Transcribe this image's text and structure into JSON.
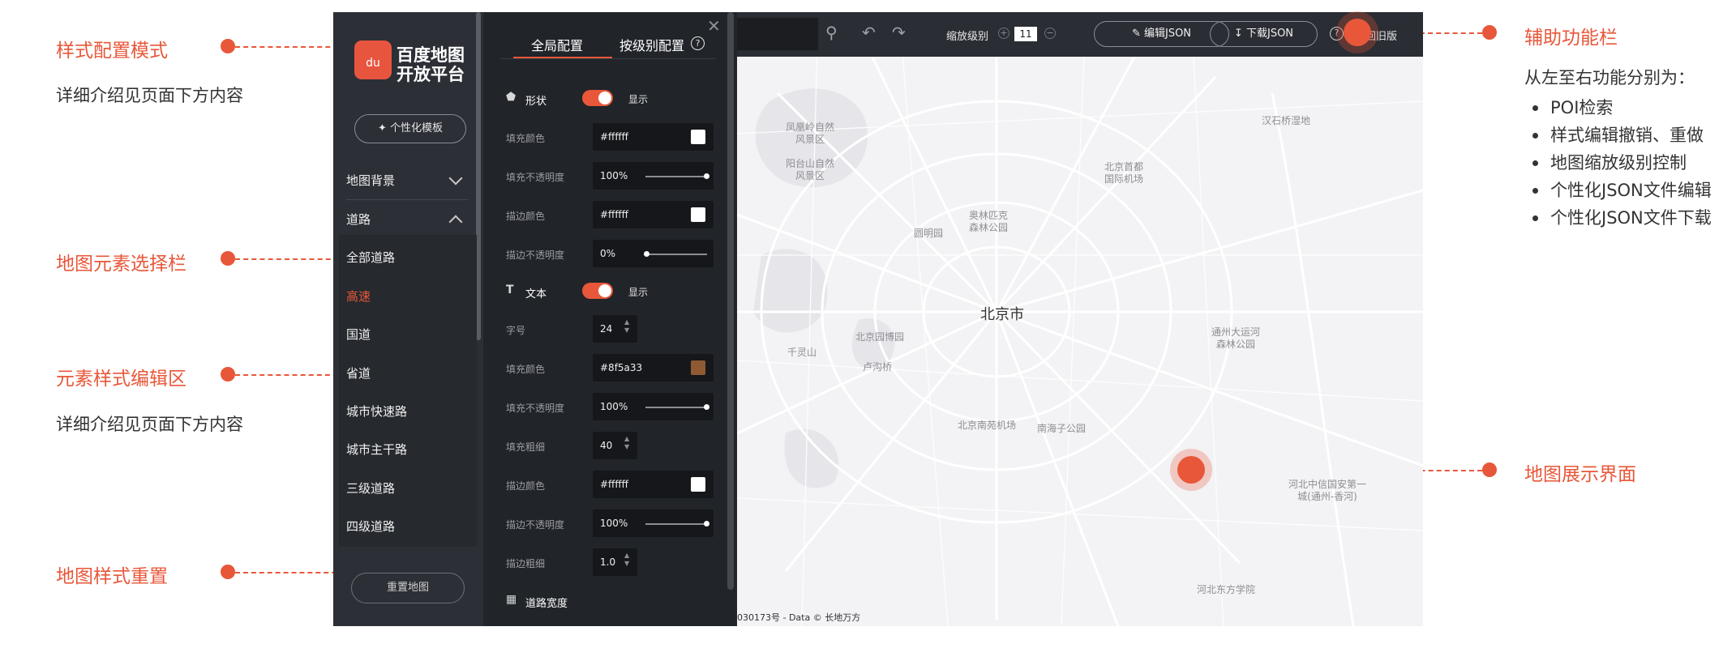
{
  "annotations": {
    "style_mode": {
      "label": "样式配置模式",
      "desc": "详细介绍见页面下方内容"
    },
    "element_select": {
      "label": "地图元素选择栏"
    },
    "style_edit": {
      "label": "元素样式编辑区",
      "desc": "详细介绍见页面下方内容"
    },
    "reset": {
      "label": "地图样式重置"
    },
    "toolbar": {
      "label": "辅助功能栏"
    },
    "display": {
      "label": "地图展示界面"
    },
    "functions_title": "从左至右功能分别为：",
    "functions": [
      "POI检索",
      "样式编辑撤销、重做",
      "地图缩放级别控制",
      "个性化JSON文件编辑",
      "个性化JSON文件下载"
    ]
  },
  "logo": {
    "badge": "du",
    "line1": "百度地图",
    "line2": "开放平台"
  },
  "sidebar": {
    "template_button": "个性化模板",
    "groups": [
      {
        "label": "地图背景",
        "expanded": false
      },
      {
        "label": "道路",
        "expanded": true
      }
    ],
    "items": [
      "全部道路",
      "高速",
      "国道",
      "省道",
      "城市快速路",
      "城市主干路",
      "三级道路",
      "四级道路"
    ],
    "active_item": "高速",
    "reset_button": "重置地图"
  },
  "editor": {
    "tabs": [
      "全局配置",
      "按级别配置"
    ],
    "active_tab": "全局配置",
    "shape": {
      "title": "形状",
      "toggle_label": "显示",
      "rows": [
        {
          "label": "填充颜色",
          "value": "#ffffff",
          "color": "#ffffff"
        },
        {
          "label": "填充不透明度",
          "value": "100%",
          "slider": 1.0
        },
        {
          "label": "描边颜色",
          "value": "#ffffff",
          "color": "#ffffff"
        },
        {
          "label": "描边不透明度",
          "value": "0%",
          "slider": 0.0
        }
      ]
    },
    "text": {
      "title": "文本",
      "toggle_label": "显示",
      "rows": [
        {
          "label": "字号",
          "value": "24"
        },
        {
          "label": "填充颜色",
          "value": "#8f5a33",
          "color": "#8f5a33"
        },
        {
          "label": "填充不透明度",
          "value": "100%",
          "slider": 1.0
        },
        {
          "label": "填充粗细",
          "value": "40"
        },
        {
          "label": "描边颜色",
          "value": "#ffffff",
          "color": "#ffffff"
        },
        {
          "label": "描边不透明度",
          "value": "100%",
          "slider": 1.0
        },
        {
          "label": "描边粗细",
          "value": "1.0"
        }
      ]
    },
    "road_width": {
      "title": "道路宽度"
    }
  },
  "toolbar": {
    "zoom_label": "缩放级别",
    "zoom_level": "11",
    "edit_json": "编辑JSON",
    "download_json": "下载JSON",
    "old_version": "回旧版"
  },
  "map": {
    "city": "北京市",
    "labels": [
      "凤凰岭自然\n风景区",
      "阳台山自然\n风景区",
      "北京首都\n国际机场",
      "汉石桥湿地",
      "奥林匹克\n森林公园",
      "圆明园",
      "北京园博园",
      "千灵山",
      "卢沟桥",
      "通州大运河\n森林公园",
      "北京南苑机场",
      "南海子公园",
      "河北中信国安第一\n城(通州-香河)",
      "河北东方学院"
    ],
    "copyright": "030173号 - Data © 长地万方"
  }
}
